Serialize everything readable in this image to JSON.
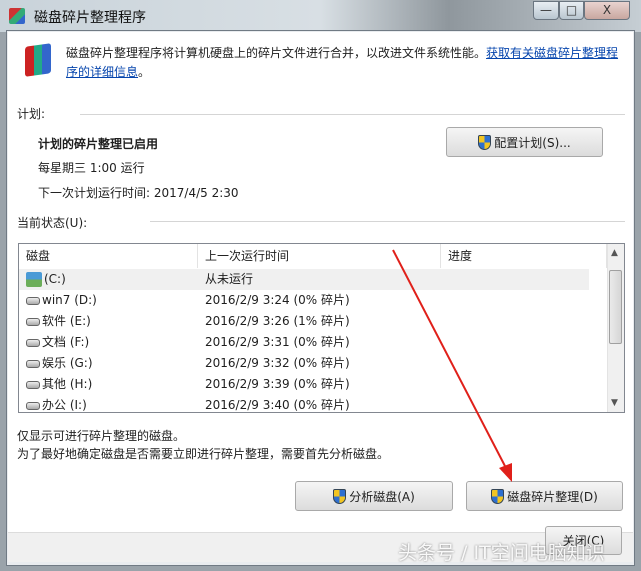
{
  "window": {
    "title": "磁盘碎片整理程序",
    "minimize": "—",
    "maximize": "□",
    "close": "X"
  },
  "intro": {
    "text": "磁盘碎片整理程序将计算机硬盘上的碎片文件进行合并，以改进文件系统性能。",
    "link_part1": "获取有关磁盘碎片整理程",
    "link_part2": "序的详细信息",
    "tail": "。"
  },
  "schedule": {
    "label": "计划:",
    "status": "计划的碎片整理已启用",
    "frequency": "每星期三  1:00 运行",
    "next_run": "下一次计划运行时间: 2017/4/5 2:30",
    "configure_button": "配置计划(S)..."
  },
  "current_status": {
    "label": "当前状态(U):",
    "columns": [
      "磁盘",
      "上一次运行时间",
      "进度"
    ],
    "rows": [
      {
        "disk": "(C:)",
        "last_run": "从未运行",
        "icon": "system-drive-icon"
      },
      {
        "disk": "win7 (D:)",
        "last_run": "2016/2/9 3:24 (0% 碎片)",
        "icon": "drive-icon"
      },
      {
        "disk": "软件 (E:)",
        "last_run": "2016/2/9 3:26 (1% 碎片)",
        "icon": "drive-icon"
      },
      {
        "disk": "文档 (F:)",
        "last_run": "2016/2/9 3:31 (0% 碎片)",
        "icon": "drive-icon"
      },
      {
        "disk": "娱乐 (G:)",
        "last_run": "2016/2/9 3:32 (0% 碎片)",
        "icon": "drive-icon"
      },
      {
        "disk": "其他 (H:)",
        "last_run": "2016/2/9 3:39 (0% 碎片)",
        "icon": "drive-icon"
      },
      {
        "disk": "办公 (I:)",
        "last_run": "2016/2/9 3:40 (0% 碎片)",
        "icon": "drive-icon"
      }
    ]
  },
  "notes": [
    "仅显示可进行碎片整理的磁盘。",
    "为了最好地确定磁盘是否需要立即进行碎片整理，需要首先分析磁盘。"
  ],
  "buttons": {
    "analyze": "分析磁盘(A)",
    "defragment": "磁盘碎片整理(D)",
    "close": "关闭(C)"
  },
  "watermark": "头条号 / IT空间电脑知识",
  "colors": {
    "arrow": "#e0201a",
    "link": "#0645ad"
  }
}
